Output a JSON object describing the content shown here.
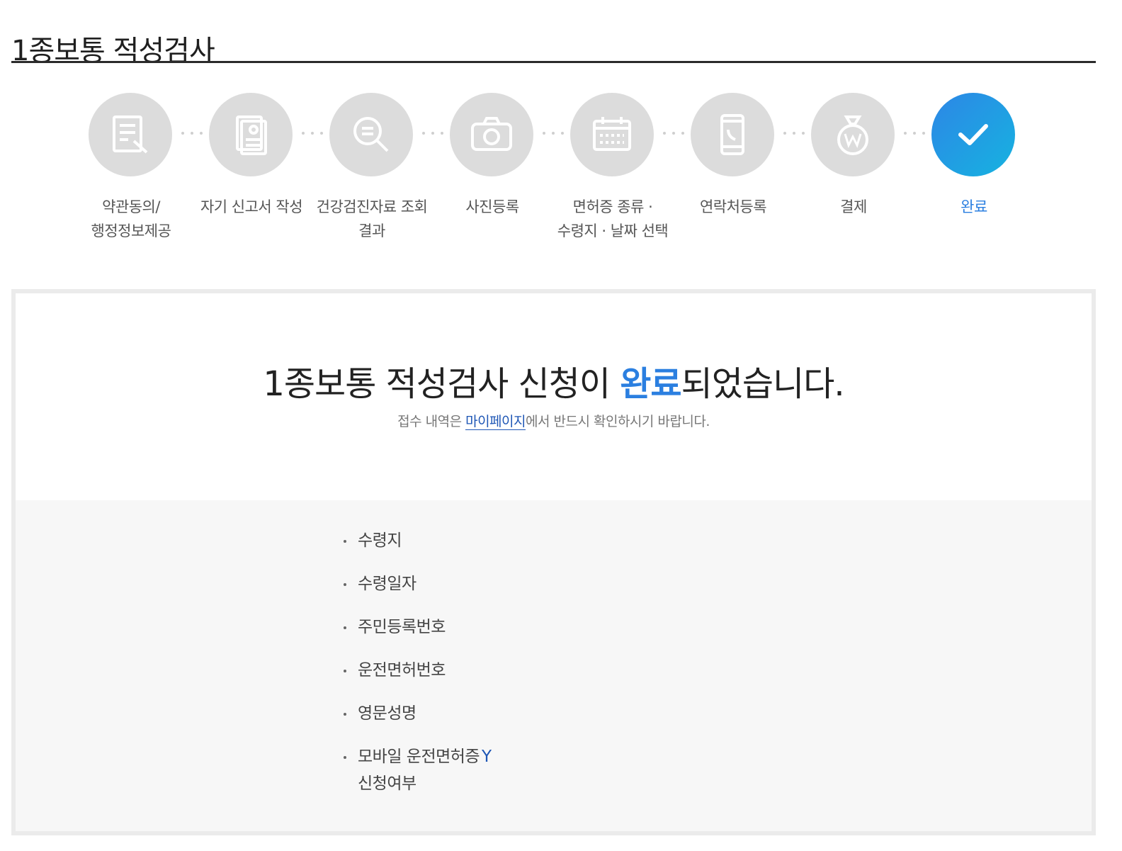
{
  "page": {
    "title": "1종보통 적성검사"
  },
  "steps": [
    {
      "label": "약관동의/\n행정정보제공",
      "icon": "document-pen-icon",
      "active": false
    },
    {
      "label": "자기 신고서 작성",
      "icon": "id-document-icon",
      "active": false
    },
    {
      "label": "건강검진자료 조회\n결과",
      "icon": "search-document-icon",
      "active": false
    },
    {
      "label": "사진등록",
      "icon": "camera-icon",
      "active": false
    },
    {
      "label": "면허증 종류 ·\n수령지 · 날짜 선택",
      "icon": "calendar-icon",
      "active": false
    },
    {
      "label": "연락처등록",
      "icon": "mobile-phone-icon",
      "active": false
    },
    {
      "label": "결제",
      "icon": "money-bag-icon",
      "active": false
    },
    {
      "label": "완료",
      "icon": "check-icon",
      "active": true
    }
  ],
  "completion": {
    "headline_before": "1종보통 적성검사 신청이 ",
    "headline_highlight": "완료",
    "headline_after": "되었습니다.",
    "sub_before": "접수 내역은 ",
    "sub_link": "마이페이지",
    "sub_after": "에서 반드시 확인하시기 바랍니다."
  },
  "info": [
    {
      "label": "수령지",
      "value": ""
    },
    {
      "label": "수령일자",
      "value": ""
    },
    {
      "label": "주민등록번호",
      "value": ""
    },
    {
      "label": "운전면허번호",
      "value": ""
    },
    {
      "label": "영문성명",
      "value": ""
    },
    {
      "label": "모바일 운전면허증 신청여부",
      "value": "Y"
    }
  ],
  "colors": {
    "accent": "#2b7fe0",
    "link": "#1e56b5",
    "inactive_step": "#dcdcdc"
  }
}
